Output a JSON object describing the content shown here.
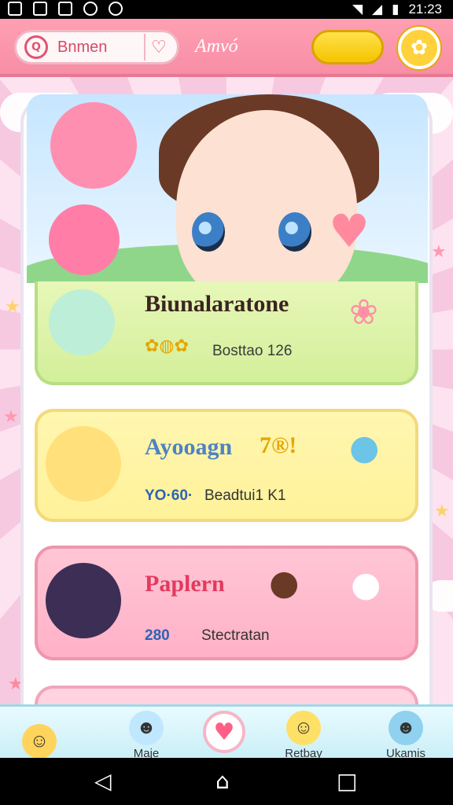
{
  "status_bar": {
    "time": "21:23"
  },
  "top_bar": {
    "search_text": "Bnmen",
    "title": "Amvó"
  },
  "cards": [
    {
      "title": "Biunalaratone",
      "subtitle": "Bosttao 126"
    },
    {
      "title": "Ayooagn",
      "title_badge": "7®!",
      "subtitle_prefix": "YO·60·",
      "subtitle": "Beadtui1 K1"
    },
    {
      "title": "Paplern",
      "subtitle_prefix": "280",
      "subtitle": "Stectratan"
    }
  ],
  "bottom_nav": {
    "items": [
      {
        "label": ""
      },
      {
        "label": "Maje"
      },
      {
        "label": ""
      },
      {
        "label": "Retbay"
      },
      {
        "label": "Ukamis"
      }
    ]
  },
  "colors": {
    "top_bar": "#f78ea6",
    "card_green": "#d3ef9a",
    "card_yellow": "#fff29a",
    "card_pink": "#ffb1c7",
    "accent_yellow": "#f5c400"
  }
}
